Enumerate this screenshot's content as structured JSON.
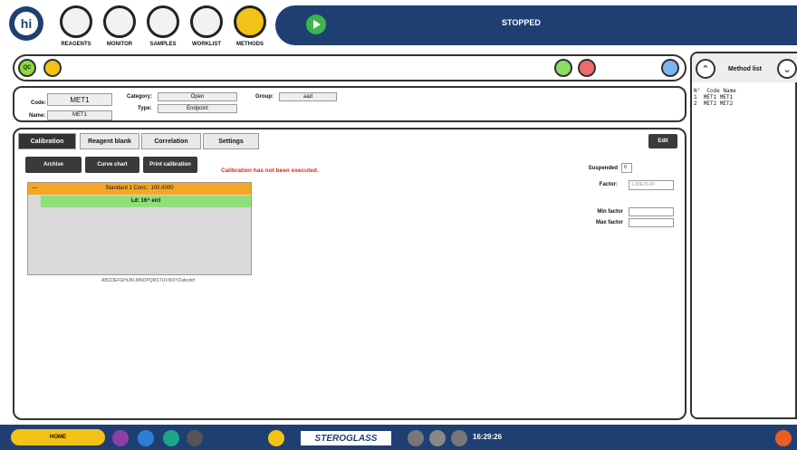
{
  "top": {
    "logo": "hi",
    "nav": [
      "REAGENTS",
      "MONITOR",
      "SAMPLES",
      "WORKLIST",
      "METHODS"
    ],
    "status": "STOPPED"
  },
  "bar2": {
    "qc": "QC"
  },
  "header": {
    "code_label": "Code:",
    "code_value": "MET1",
    "name_label": "Name:",
    "name_value": "MET1",
    "category_label": "Category:",
    "category_value": "Open",
    "type_label": "Type:",
    "type_value": "Endpoint",
    "group_label": "Group:",
    "group_value": "aad"
  },
  "tabs": [
    "Calibration",
    "Reagent blank",
    "Correlation",
    "Settings"
  ],
  "edit": "Edit",
  "buttons": {
    "archive": "Archive",
    "curve": "Curve chart",
    "print": "Print calibration"
  },
  "error": "Calibration has not been executed.",
  "list": {
    "row1_marker": "—",
    "row1": "Standard 1 Conc.: 100.0000",
    "row2": "Ld: 16^ e/cl",
    "footer": "ABCDEFGHIJKLMNOPQRSTUVWXYZabcdef"
  },
  "right": {
    "suspended_label": "Suspended",
    "suspended_value": "0",
    "factor_label": "Factor:",
    "factor_value": "1.00E16-00",
    "min_label": "Min factor",
    "max_label": "Max factor"
  },
  "side": {
    "title": "Method list",
    "columns": [
      "N°",
      "Code",
      "Name"
    ],
    "rows": [
      [
        "1",
        "MET1",
        "MET1"
      ],
      [
        "2",
        "MET2",
        "MET2"
      ]
    ]
  },
  "bottom": {
    "home": "HOME",
    "brand": "STEROGLASS",
    "time": "16:29:26"
  }
}
